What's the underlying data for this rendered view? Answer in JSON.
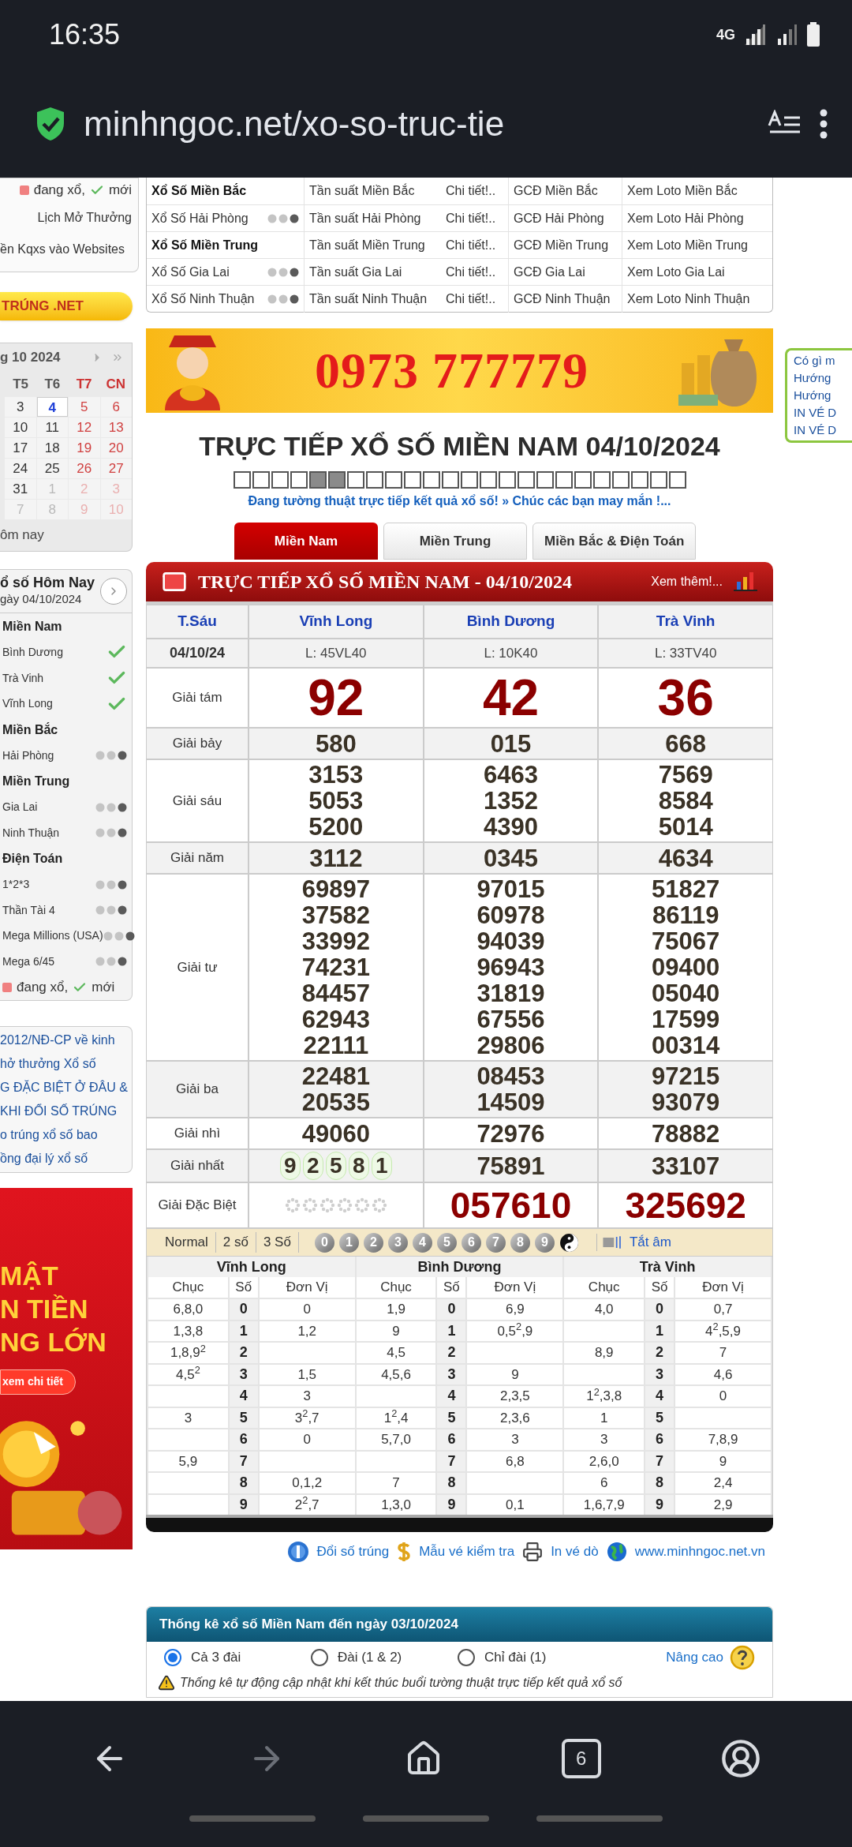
{
  "status_bar": {
    "time": "16:35",
    "network": "4G"
  },
  "browser": {
    "url": "minhngoc.net/xo-so-truc-tie"
  },
  "sidebar": {
    "legend_top": {
      "live": "đang xổ,",
      "new": "mới"
    },
    "schedule_link": "Lịch Mở Thưởng",
    "embed_link": "ền Kqxs vào Websites",
    "yellow_button": "TRÚNG .NET",
    "calendar": {
      "title": "g 10 2024",
      "weekdays": [
        {
          "label": "T5",
          "weekend": false
        },
        {
          "label": "T6",
          "weekend": false
        },
        {
          "label": "T7",
          "weekend": true
        },
        {
          "label": "CN",
          "weekend": true
        }
      ],
      "weeks": [
        [
          {
            "day": "3",
            "other_month": false,
            "selected": false
          },
          {
            "day": "4",
            "other_month": false,
            "selected": true
          },
          {
            "day": "5",
            "other_month": false,
            "selected": false
          },
          {
            "day": "6",
            "other_month": false,
            "selected": false
          }
        ],
        [
          {
            "day": "10",
            "other_month": false,
            "selected": false
          },
          {
            "day": "11",
            "other_month": false,
            "selected": false
          },
          {
            "day": "12",
            "other_month": false,
            "selected": false
          },
          {
            "day": "13",
            "other_month": false,
            "selected": false
          }
        ],
        [
          {
            "day": "17",
            "other_month": false,
            "selected": false
          },
          {
            "day": "18",
            "other_month": false,
            "selected": false
          },
          {
            "day": "19",
            "other_month": false,
            "selected": false
          },
          {
            "day": "20",
            "other_month": false,
            "selected": false
          }
        ],
        [
          {
            "day": "24",
            "other_month": false,
            "selected": false
          },
          {
            "day": "25",
            "other_month": false,
            "selected": false
          },
          {
            "day": "26",
            "other_month": false,
            "selected": false
          },
          {
            "day": "27",
            "other_month": false,
            "selected": false
          }
        ],
        [
          {
            "day": "31",
            "other_month": false,
            "selected": false
          },
          {
            "day": "1",
            "other_month": true,
            "selected": false
          },
          {
            "day": "2",
            "other_month": true,
            "selected": false
          },
          {
            "day": "3",
            "other_month": true,
            "selected": false
          }
        ],
        [
          {
            "day": "7",
            "other_month": true,
            "selected": false
          },
          {
            "day": "8",
            "other_month": true,
            "selected": false
          },
          {
            "day": "9",
            "other_month": true,
            "selected": false
          },
          {
            "day": "10",
            "other_month": true,
            "selected": false
          }
        ]
      ],
      "footer": "ôm nay"
    },
    "today_box": {
      "title": "ổ số Hôm Nay",
      "date": "gày 04/10/2024",
      "groups": [
        {
          "name": "Miền Nam",
          "items": [
            {
              "name": "Bình Dương",
              "kind": "done"
            },
            {
              "name": "Trà Vinh",
              "kind": "done"
            },
            {
              "name": "Vĩnh Long",
              "kind": "done"
            }
          ]
        },
        {
          "name": "Miền Bắc",
          "items": [
            {
              "name": "Hải Phòng",
              "kind": "waiting"
            }
          ]
        },
        {
          "name": "Miền Trung",
          "items": [
            {
              "name": "Gia Lai",
              "kind": "waiting"
            },
            {
              "name": "Ninh Thuận",
              "kind": "waiting"
            }
          ]
        },
        {
          "name": "Điện Toán",
          "items": [
            {
              "name": "1*2*3",
              "kind": "waiting"
            },
            {
              "name": "Thần Tài 4",
              "kind": "waiting"
            },
            {
              "name": "Mega Millions (USA)",
              "kind": "waiting"
            },
            {
              "name": "Mega 6/45",
              "kind": "waiting"
            }
          ]
        }
      ],
      "legend": {
        "live": "đang xổ,",
        "new": "mới"
      }
    },
    "news": [
      "2012/NĐ-CP về kinh",
      "hở thưởng Xổ số",
      "G ĐẶC BIỆT Ở ĐÂU &",
      "KHI ĐỔI SỐ TRÚNG",
      "o trúng xổ số bao",
      "ồng đại lý xổ số"
    ],
    "ad": {
      "lines": [
        "MẬT",
        "N TIỀN",
        "NG LỚN"
      ],
      "button": "xem chi tiết"
    }
  },
  "links_table": {
    "rows": [
      {
        "kind": "region",
        "name": "Xổ Số Miền Bắc",
        "frequency": "Tần suất Miền Bắc",
        "detail": "Chi tiết!..",
        "gcd": "GCĐ Miền Bắc",
        "loto": "Xem Loto Miền Bắc"
      },
      {
        "kind": "province",
        "name": "Xổ Số Hải Phòng",
        "frequency": "Tần suất Hải Phòng",
        "detail": "Chi tiết!..",
        "gcd": "GCĐ Hải Phòng",
        "loto": "Xem Loto Hải Phòng"
      },
      {
        "kind": "region",
        "name": "Xổ Số Miền Trung",
        "frequency": "Tần suất Miền Trung",
        "detail": "Chi tiết!..",
        "gcd": "GCĐ Miền Trung",
        "loto": "Xem Loto Miền Trung"
      },
      {
        "kind": "province",
        "name": "Xổ Số Gia Lai",
        "frequency": "Tần suất Gia Lai",
        "detail": "Chi tiết!..",
        "gcd": "GCĐ Gia Lai",
        "loto": "Xem Loto Gia Lai"
      },
      {
        "kind": "province",
        "name": "Xổ Số Ninh Thuận",
        "frequency": "Tần suất Ninh Thuận",
        "detail": "Chi tiết!..",
        "gcd": "GCĐ Ninh Thuận",
        "loto": "Xem Loto Ninh Thuận"
      }
    ]
  },
  "banner": {
    "phone": "0973 777779"
  },
  "right_panel": {
    "items": [
      "Có gì m",
      "Hướng",
      "Hướng",
      "IN VÉ D",
      "IN VÉ D"
    ]
  },
  "title": "TRỰC TIẾP XỔ SỐ MIỀN NAM 04/10/2024",
  "progress": [
    {
      "filled": false
    },
    {
      "filled": false
    },
    {
      "filled": false
    },
    {
      "filled": false
    },
    {
      "filled": true
    },
    {
      "filled": true
    },
    {
      "filled": false
    },
    {
      "filled": false
    },
    {
      "filled": false
    },
    {
      "filled": false
    },
    {
      "filled": false
    },
    {
      "filled": false
    },
    {
      "filled": false
    },
    {
      "filled": false
    },
    {
      "filled": false
    },
    {
      "filled": false
    },
    {
      "filled": false
    },
    {
      "filled": false
    },
    {
      "filled": false
    },
    {
      "filled": false
    },
    {
      "filled": false
    },
    {
      "filled": false
    },
    {
      "filled": false
    },
    {
      "filled": false
    }
  ],
  "ticker": "Đang tường thuật trực tiếp kết quả xổ số! » Chúc các bạn may mắn !...",
  "tabs": [
    {
      "label": "Miền Nam",
      "selected": true
    },
    {
      "label": "Miền Trung",
      "selected": false
    },
    {
      "label": "Miền Bắc & Điện Toán",
      "selected": false
    }
  ],
  "results": {
    "header": "TRỰC TIẾP XỔ SỐ MIỀN NAM - 04/10/2024",
    "more": "Xem thêm!...",
    "day": "T.Sáu",
    "date": "04/10/24",
    "stations": [
      {
        "name": "Vĩnh Long",
        "ticket": "L: 45VL40"
      },
      {
        "name": "Bình Dương",
        "ticket": "L: 10K40"
      },
      {
        "name": "Trà Vinh",
        "ticket": "L: 33TV40"
      }
    ],
    "prizes": [
      {
        "name": "Giải tám",
        "kind": "eighth",
        "cells": [
          {
            "kind": "done",
            "numbers": [
              "92"
            ]
          },
          {
            "kind": "done",
            "numbers": [
              "42"
            ]
          },
          {
            "kind": "done",
            "numbers": [
              "36"
            ]
          }
        ]
      },
      {
        "name": "Giải bảy",
        "kind": "regular",
        "cells": [
          {
            "kind": "done",
            "numbers": [
              "580"
            ]
          },
          {
            "kind": "done",
            "numbers": [
              "015"
            ]
          },
          {
            "kind": "done",
            "numbers": [
              "668"
            ]
          }
        ]
      },
      {
        "name": "Giải sáu",
        "kind": "regular",
        "cells": [
          {
            "kind": "done",
            "numbers": [
              "3153",
              "5053",
              "5200"
            ]
          },
          {
            "kind": "done",
            "numbers": [
              "6463",
              "1352",
              "4390"
            ]
          },
          {
            "kind": "done",
            "numbers": [
              "7569",
              "8584",
              "5014"
            ]
          }
        ]
      },
      {
        "name": "Giải năm",
        "kind": "regular",
        "cells": [
          {
            "kind": "done",
            "numbers": [
              "3112"
            ]
          },
          {
            "kind": "done",
            "numbers": [
              "0345"
            ]
          },
          {
            "kind": "done",
            "numbers": [
              "4634"
            ]
          }
        ]
      },
      {
        "name": "Giải tư",
        "kind": "regular",
        "cells": [
          {
            "kind": "done",
            "numbers": [
              "69897",
              "37582",
              "33992",
              "74231",
              "84457",
              "62943",
              "22111"
            ]
          },
          {
            "kind": "done",
            "numbers": [
              "97015",
              "60978",
              "94039",
              "96943",
              "31819",
              "67556",
              "29806"
            ]
          },
          {
            "kind": "done",
            "numbers": [
              "51827",
              "86119",
              "75067",
              "09400",
              "05040",
              "17599",
              "00314"
            ]
          }
        ]
      },
      {
        "name": "Giải ba",
        "kind": "regular",
        "cells": [
          {
            "kind": "done",
            "numbers": [
              "22481",
              "20535"
            ]
          },
          {
            "kind": "done",
            "numbers": [
              "08453",
              "14509"
            ]
          },
          {
            "kind": "done",
            "numbers": [
              "97215",
              "93079"
            ]
          }
        ]
      },
      {
        "name": "Giải nhì",
        "kind": "regular",
        "cells": [
          {
            "kind": "done",
            "numbers": [
              "49060"
            ]
          },
          {
            "kind": "done",
            "numbers": [
              "72976"
            ]
          },
          {
            "kind": "done",
            "numbers": [
              "78882"
            ]
          }
        ]
      },
      {
        "name": "Giải nhất",
        "kind": "regular",
        "cells": [
          {
            "kind": "drawing",
            "digits": [
              "9",
              "2",
              "5",
              "8",
              "1"
            ]
          },
          {
            "kind": "done",
            "numbers": [
              "75891"
            ]
          },
          {
            "kind": "done",
            "numbers": [
              "33107"
            ]
          }
        ]
      },
      {
        "name": "Giải Đặc Biệt",
        "kind": "special",
        "cells": [
          {
            "kind": "pending"
          },
          {
            "kind": "done",
            "numbers": [
              "057610"
            ]
          },
          {
            "kind": "done",
            "numbers": [
              "325692"
            ]
          }
        ]
      }
    ]
  },
  "toolbar": {
    "modes": [
      "Normal",
      "2 số",
      "3 Số"
    ],
    "balls": [
      "0",
      "1",
      "2",
      "3",
      "4",
      "5",
      "6",
      "7",
      "8",
      "9"
    ],
    "mute": "Tắt âm"
  },
  "loto": {
    "stations": [
      {
        "name": "Vĩnh Long",
        "headers": [
          "Chục",
          "Số",
          "Đơn Vị"
        ],
        "rows": [
          {
            "tens": "6,8,0",
            "digit": "0",
            "units": "0"
          },
          {
            "tens": "1,3,8",
            "digit": "1",
            "units": "1,2"
          },
          {
            "tens": "1,8,9$^{2}$",
            "digit": "2"
          },
          {
            "tens": "4,5$^{2}$",
            "digit": "3",
            "units": "1,5"
          },
          {
            "digit": "4",
            "units": "3"
          },
          {
            "tens": "3",
            "digit": "5",
            "units": "3$^{2}$,7"
          },
          {
            "digit": "6",
            "units": "0"
          },
          {
            "tens": "5,9",
            "digit": "7"
          },
          {
            "digit": "8",
            "units": "0,1,2"
          },
          {
            "digit": "9",
            "units": "2$^{2}$,7"
          }
        ]
      },
      {
        "name": "Bình Dương",
        "headers": [
          "Chục",
          "Số",
          "Đơn Vị"
        ],
        "rows": [
          {
            "tens": "1,9",
            "digit": "0",
            "units": "6,9"
          },
          {
            "tens": "9",
            "digit": "1",
            "units": "0,5$^{2}$,9"
          },
          {
            "tens": "4,5",
            "digit": "2"
          },
          {
            "tens": "4,5,6",
            "digit": "3",
            "units": "9"
          },
          {
            "digit": "4",
            "units": "2,3,5"
          },
          {
            "tens": "1$^{2}$,4",
            "digit": "5",
            "units": "2,3,6"
          },
          {
            "tens": "5,7,0",
            "digit": "6",
            "units": "3"
          },
          {
            "digit": "7",
            "units": "6,8"
          },
          {
            "tens": "7",
            "digit": "8"
          },
          {
            "tens": "1,3,0",
            "digit": "9",
            "units": "0,1"
          }
        ]
      },
      {
        "name": "Trà Vinh",
        "headers": [
          "Chục",
          "Số",
          "Đơn Vị"
        ],
        "rows": [
          {
            "tens": "4,0",
            "digit": "0",
            "units": "0,7"
          },
          {
            "digit": "1",
            "units": "4$^{2}$,5,9"
          },
          {
            "tens": "8,9",
            "digit": "2",
            "units": "7"
          },
          {
            "digit": "3",
            "units": "4,6"
          },
          {
            "tens": "1$^{2}$,3,8",
            "digit": "4",
            "units": "0"
          },
          {
            "tens": "1",
            "digit": "5"
          },
          {
            "tens": "3",
            "digit": "6",
            "units": "7,8,9"
          },
          {
            "tens": "2,6,0",
            "digit": "7",
            "units": "9"
          },
          {
            "tens": "6",
            "digit": "8",
            "units": "2,4"
          },
          {
            "tens": "1,6,7,9",
            "digit": "9",
            "units": "2,9"
          }
        ]
      }
    ]
  },
  "footer_links": [
    {
      "kind": "exchange",
      "label": "Đổi số trúng"
    },
    {
      "kind": "ticket",
      "label": "Mẫu vé kiểm tra"
    },
    {
      "kind": "print",
      "label": "In vé dò"
    },
    {
      "kind": "web",
      "label": "www.minhngoc.net.vn"
    }
  ],
  "stats": {
    "title": "Thống kê xổ số Miền Nam đến ngày 03/10/2024",
    "options": [
      {
        "label": "Cả 3 đài",
        "selected": true
      },
      {
        "label": "Đài (1 & 2)",
        "selected": false
      },
      {
        "label": "Chỉ đài (1)",
        "selected": false
      }
    ],
    "advanced": "Nâng cao",
    "note": "Thống kê tự động cập nhật khi kết thúc buổi tường thuật trực tiếp kết quả xổ số"
  },
  "nav": {
    "forward": {
      "disabled": true
    },
    "tabs_count": "6"
  }
}
